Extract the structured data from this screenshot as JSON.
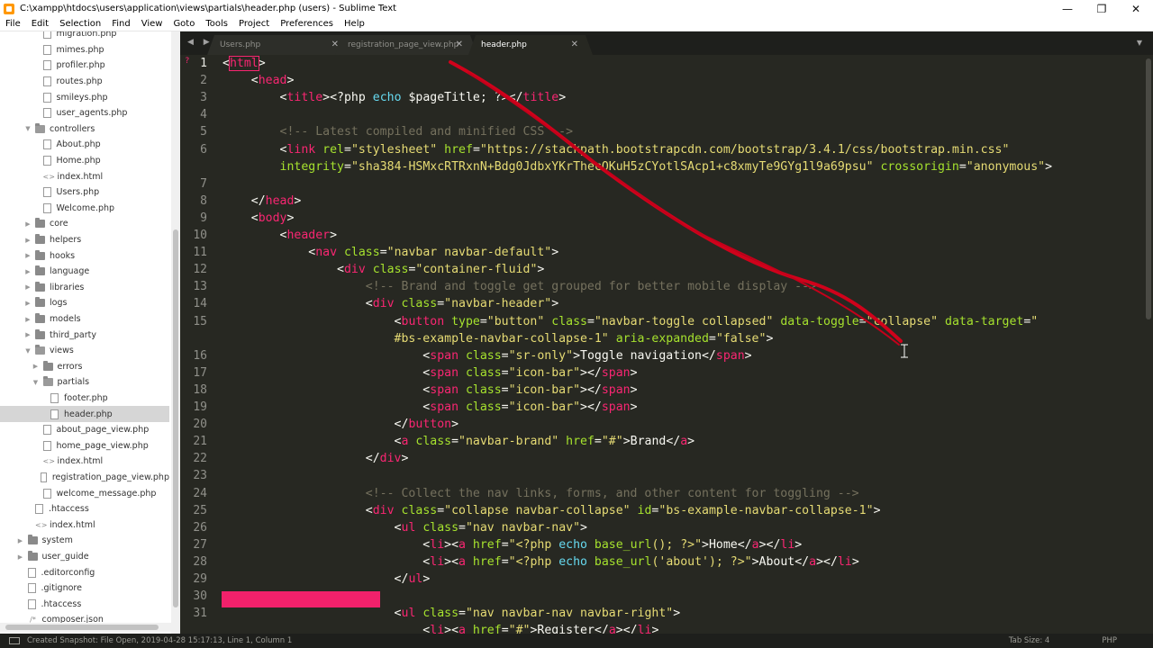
{
  "window": {
    "title": "C:\\xampp\\htdocs\\users\\application\\views\\partials\\header.php (users) - Sublime Text",
    "minimize": "—",
    "maximize": "❐",
    "close": "✕"
  },
  "menu": [
    "File",
    "Edit",
    "Selection",
    "Find",
    "View",
    "Goto",
    "Tools",
    "Project",
    "Preferences",
    "Help"
  ],
  "sidebar": {
    "items": [
      {
        "label": "migration.php",
        "kind": "file",
        "indent": 3
      },
      {
        "label": "mimes.php",
        "kind": "file",
        "indent": 3
      },
      {
        "label": "profiler.php",
        "kind": "file",
        "indent": 3
      },
      {
        "label": "routes.php",
        "kind": "file",
        "indent": 3
      },
      {
        "label": "smileys.php",
        "kind": "file",
        "indent": 3
      },
      {
        "label": "user_agents.php",
        "kind": "file",
        "indent": 3
      },
      {
        "label": "controllers",
        "kind": "folder-open",
        "indent": 2
      },
      {
        "label": "About.php",
        "kind": "file",
        "indent": 3
      },
      {
        "label": "Home.php",
        "kind": "file",
        "indent": 3
      },
      {
        "label": "index.html",
        "kind": "code",
        "indent": 3
      },
      {
        "label": "Users.php",
        "kind": "file",
        "indent": 3
      },
      {
        "label": "Welcome.php",
        "kind": "file",
        "indent": 3
      },
      {
        "label": "core",
        "kind": "folder",
        "indent": 2
      },
      {
        "label": "helpers",
        "kind": "folder",
        "indent": 2
      },
      {
        "label": "hooks",
        "kind": "folder",
        "indent": 2
      },
      {
        "label": "language",
        "kind": "folder",
        "indent": 2
      },
      {
        "label": "libraries",
        "kind": "folder",
        "indent": 2
      },
      {
        "label": "logs",
        "kind": "folder",
        "indent": 2
      },
      {
        "label": "models",
        "kind": "folder",
        "indent": 2
      },
      {
        "label": "third_party",
        "kind": "folder",
        "indent": 2
      },
      {
        "label": "views",
        "kind": "folder-open",
        "indent": 2
      },
      {
        "label": "errors",
        "kind": "folder",
        "indent": 3
      },
      {
        "label": "partials",
        "kind": "folder-open",
        "indent": 3
      },
      {
        "label": "footer.php",
        "kind": "file",
        "indent": 4
      },
      {
        "label": "header.php",
        "kind": "file",
        "indent": 4,
        "selected": true
      },
      {
        "label": "about_page_view.php",
        "kind": "file",
        "indent": 3
      },
      {
        "label": "home_page_view.php",
        "kind": "file",
        "indent": 3
      },
      {
        "label": "index.html",
        "kind": "code",
        "indent": 3
      },
      {
        "label": "registration_page_view.php",
        "kind": "file",
        "indent": 3
      },
      {
        "label": "welcome_message.php",
        "kind": "file",
        "indent": 3
      },
      {
        "label": ".htaccess",
        "kind": "file",
        "indent": 2
      },
      {
        "label": "index.html",
        "kind": "code",
        "indent": 2
      },
      {
        "label": "system",
        "kind": "folder",
        "indent": 1
      },
      {
        "label": "user_guide",
        "kind": "folder",
        "indent": 1
      },
      {
        "label": ".editorconfig",
        "kind": "file",
        "indent": 1
      },
      {
        "label": ".gitignore",
        "kind": "file",
        "indent": 1
      },
      {
        "label": ".htaccess",
        "kind": "file",
        "indent": 1
      },
      {
        "label": "composer.json",
        "kind": "json",
        "indent": 1
      }
    ]
  },
  "tabs": {
    "nav": "◀ ▶",
    "dropdown": "▼",
    "items": [
      {
        "label": "Users.php",
        "active": false
      },
      {
        "label": "registration_page_view.php",
        "active": false
      },
      {
        "label": "header.php",
        "active": true
      }
    ],
    "close_glyph": "✕"
  },
  "editor": {
    "current_line": 1,
    "error_marker": "?",
    "lines": [
      {
        "n": 1,
        "tokens": [
          [
            "v",
            "<"
          ],
          [
            "t",
            "html"
          ],
          [
            "v",
            ">"
          ]
        ]
      },
      {
        "n": 2,
        "tokens": [
          [
            "v",
            "    <"
          ],
          [
            "t",
            "head"
          ],
          [
            "v",
            ">"
          ]
        ]
      },
      {
        "n": 3,
        "tokens": [
          [
            "v",
            "        <"
          ],
          [
            "t",
            "title"
          ],
          [
            "v",
            "><?php "
          ],
          [
            "k",
            "echo"
          ],
          [
            "v",
            " $pageTitle; ?></"
          ],
          [
            "t",
            "title"
          ],
          [
            "v",
            ">"
          ]
        ]
      },
      {
        "n": 4,
        "tokens": []
      },
      {
        "n": 5,
        "tokens": [
          [
            "c",
            "        <!-- Latest compiled and minified CSS -->"
          ]
        ]
      },
      {
        "n": 6,
        "tokens": [
          [
            "v",
            "        <"
          ],
          [
            "t",
            "link"
          ],
          [
            "a",
            " rel"
          ],
          [
            "v",
            "="
          ],
          [
            "s",
            "\"stylesheet\""
          ],
          [
            "a",
            " href"
          ],
          [
            "v",
            "="
          ],
          [
            "s",
            "\"https://stackpath.bootstrapcdn.com/bootstrap/3.4.1/css/bootstrap.min.css\""
          ]
        ]
      },
      {
        "n": null,
        "tokens": [
          [
            "a",
            "        integrity"
          ],
          [
            "v",
            "="
          ],
          [
            "s",
            "\"sha384-HSMxcRTRxnN+Bdg0JdbxYKrThecOKuH5zCYotlSAcp1+c8xmyTe9GYg1l9a69psu\""
          ],
          [
            "a",
            " crossorigin"
          ],
          [
            "v",
            "="
          ],
          [
            "s",
            "\"anonymous\""
          ],
          [
            "v",
            ">"
          ]
        ]
      },
      {
        "n": 7,
        "tokens": []
      },
      {
        "n": 8,
        "tokens": [
          [
            "v",
            "    </"
          ],
          [
            "t",
            "head"
          ],
          [
            "v",
            ">"
          ]
        ]
      },
      {
        "n": 9,
        "tokens": [
          [
            "v",
            "    <"
          ],
          [
            "t",
            "body"
          ],
          [
            "v",
            ">"
          ]
        ]
      },
      {
        "n": 10,
        "tokens": [
          [
            "v",
            "        <"
          ],
          [
            "t",
            "header"
          ],
          [
            "v",
            ">"
          ]
        ]
      },
      {
        "n": 11,
        "tokens": [
          [
            "v",
            "            <"
          ],
          [
            "t",
            "nav"
          ],
          [
            "a",
            " class"
          ],
          [
            "v",
            "="
          ],
          [
            "s",
            "\"navbar navbar-default\""
          ],
          [
            "v",
            ">"
          ]
        ]
      },
      {
        "n": 12,
        "tokens": [
          [
            "v",
            "                <"
          ],
          [
            "t",
            "div"
          ],
          [
            "a",
            " class"
          ],
          [
            "v",
            "="
          ],
          [
            "s",
            "\"container-fluid\""
          ],
          [
            "v",
            ">"
          ]
        ]
      },
      {
        "n": 13,
        "tokens": [
          [
            "c",
            "                    <!-- Brand and toggle get grouped for better mobile display -->"
          ]
        ]
      },
      {
        "n": 14,
        "tokens": [
          [
            "v",
            "                    <"
          ],
          [
            "t",
            "div"
          ],
          [
            "a",
            " class"
          ],
          [
            "v",
            "="
          ],
          [
            "s",
            "\"navbar-header\""
          ],
          [
            "v",
            ">"
          ]
        ]
      },
      {
        "n": 15,
        "tokens": [
          [
            "v",
            "                        <"
          ],
          [
            "t",
            "button"
          ],
          [
            "a",
            " type"
          ],
          [
            "v",
            "="
          ],
          [
            "s",
            "\"button\""
          ],
          [
            "a",
            " class"
          ],
          [
            "v",
            "="
          ],
          [
            "s",
            "\"navbar-toggle collapsed\""
          ],
          [
            "a",
            " data-toggle"
          ],
          [
            "v",
            "="
          ],
          [
            "s",
            "\"collapse\""
          ],
          [
            "a",
            " data-target"
          ],
          [
            "v",
            "="
          ],
          [
            "s",
            "\""
          ]
        ]
      },
      {
        "n": null,
        "tokens": [
          [
            "s",
            "                        #bs-example-navbar-collapse-1\""
          ],
          [
            "a",
            " aria-expanded"
          ],
          [
            "v",
            "="
          ],
          [
            "s",
            "\"false\""
          ],
          [
            "v",
            ">"
          ]
        ]
      },
      {
        "n": 16,
        "tokens": [
          [
            "v",
            "                            <"
          ],
          [
            "t",
            "span"
          ],
          [
            "a",
            " class"
          ],
          [
            "v",
            "="
          ],
          [
            "s",
            "\"sr-only\""
          ],
          [
            "v",
            ">Toggle navigation</"
          ],
          [
            "t",
            "span"
          ],
          [
            "v",
            ">"
          ]
        ]
      },
      {
        "n": 17,
        "tokens": [
          [
            "v",
            "                            <"
          ],
          [
            "t",
            "span"
          ],
          [
            "a",
            " class"
          ],
          [
            "v",
            "="
          ],
          [
            "s",
            "\"icon-bar\""
          ],
          [
            "v",
            "></"
          ],
          [
            "t",
            "span"
          ],
          [
            "v",
            ">"
          ]
        ]
      },
      {
        "n": 18,
        "tokens": [
          [
            "v",
            "                            <"
          ],
          [
            "t",
            "span"
          ],
          [
            "a",
            " class"
          ],
          [
            "v",
            "="
          ],
          [
            "s",
            "\"icon-bar\""
          ],
          [
            "v",
            "></"
          ],
          [
            "t",
            "span"
          ],
          [
            "v",
            ">"
          ]
        ]
      },
      {
        "n": 19,
        "tokens": [
          [
            "v",
            "                            <"
          ],
          [
            "t",
            "span"
          ],
          [
            "a",
            " class"
          ],
          [
            "v",
            "="
          ],
          [
            "s",
            "\"icon-bar\""
          ],
          [
            "v",
            "></"
          ],
          [
            "t",
            "span"
          ],
          [
            "v",
            ">"
          ]
        ]
      },
      {
        "n": 20,
        "tokens": [
          [
            "v",
            "                        </"
          ],
          [
            "t",
            "button"
          ],
          [
            "v",
            ">"
          ]
        ]
      },
      {
        "n": 21,
        "tokens": [
          [
            "v",
            "                        <"
          ],
          [
            "t",
            "a"
          ],
          [
            "a",
            " class"
          ],
          [
            "v",
            "="
          ],
          [
            "s",
            "\"navbar-brand\""
          ],
          [
            "a",
            " href"
          ],
          [
            "v",
            "="
          ],
          [
            "s",
            "\"#\""
          ],
          [
            "v",
            ">Brand</"
          ],
          [
            "t",
            "a"
          ],
          [
            "v",
            ">"
          ]
        ]
      },
      {
        "n": 22,
        "tokens": [
          [
            "v",
            "                    </"
          ],
          [
            "t",
            "div"
          ],
          [
            "v",
            ">"
          ]
        ]
      },
      {
        "n": 23,
        "tokens": []
      },
      {
        "n": 24,
        "tokens": [
          [
            "c",
            "                    <!-- Collect the nav links, forms, and other content for toggling -->"
          ]
        ]
      },
      {
        "n": 25,
        "tokens": [
          [
            "v",
            "                    <"
          ],
          [
            "t",
            "div"
          ],
          [
            "a",
            " class"
          ],
          [
            "v",
            "="
          ],
          [
            "s",
            "\"collapse navbar-collapse\""
          ],
          [
            "a",
            " id"
          ],
          [
            "v",
            "="
          ],
          [
            "s",
            "\"bs-example-navbar-collapse-1\""
          ],
          [
            "v",
            ">"
          ]
        ]
      },
      {
        "n": 26,
        "tokens": [
          [
            "v",
            "                        <"
          ],
          [
            "t",
            "ul"
          ],
          [
            "a",
            " class"
          ],
          [
            "v",
            "="
          ],
          [
            "s",
            "\"nav navbar-nav\""
          ],
          [
            "v",
            ">"
          ]
        ]
      },
      {
        "n": 27,
        "tokens": [
          [
            "v",
            "                            <"
          ],
          [
            "t",
            "li"
          ],
          [
            "v",
            "><"
          ],
          [
            "t",
            "a"
          ],
          [
            "a",
            " href"
          ],
          [
            "v",
            "="
          ],
          [
            "s",
            "\"<?php "
          ],
          [
            "k",
            "echo"
          ],
          [
            "a",
            " base_url"
          ],
          [
            "s",
            "(); ?>\""
          ],
          [
            "v",
            ">Home</"
          ],
          [
            "t",
            "a"
          ],
          [
            "v",
            "></"
          ],
          [
            "t",
            "li"
          ],
          [
            "v",
            ">"
          ]
        ]
      },
      {
        "n": 28,
        "tokens": [
          [
            "v",
            "                            <"
          ],
          [
            "t",
            "li"
          ],
          [
            "v",
            "><"
          ],
          [
            "t",
            "a"
          ],
          [
            "a",
            " href"
          ],
          [
            "v",
            "="
          ],
          [
            "s",
            "\"<?php "
          ],
          [
            "k",
            "echo"
          ],
          [
            "a",
            " base_url"
          ],
          [
            "s",
            "('about'); ?>\""
          ],
          [
            "v",
            ">About</"
          ],
          [
            "t",
            "a"
          ],
          [
            "v",
            "></"
          ],
          [
            "t",
            "li"
          ],
          [
            "v",
            ">"
          ]
        ]
      },
      {
        "n": 29,
        "tokens": [
          [
            "v",
            "                        </"
          ],
          [
            "t",
            "ul"
          ],
          [
            "v",
            ">"
          ]
        ]
      },
      {
        "n": 30,
        "tokens": []
      },
      {
        "n": 31,
        "tokens": [
          [
            "v",
            "                        <"
          ],
          [
            "t",
            "ul"
          ],
          [
            "a",
            " class"
          ],
          [
            "v",
            "="
          ],
          [
            "s",
            "\"nav navbar-nav navbar-right\""
          ],
          [
            "v",
            ">"
          ]
        ]
      },
      {
        "n": null,
        "tokens": [
          [
            "v",
            "                            <"
          ],
          [
            "t",
            "li"
          ],
          [
            "v",
            "><"
          ],
          [
            "t",
            "a"
          ],
          [
            "a",
            " href"
          ],
          [
            "v",
            "="
          ],
          [
            "s",
            "\"#\""
          ],
          [
            "v",
            ">Register</"
          ],
          [
            "t",
            "a"
          ],
          [
            "v",
            "></"
          ],
          [
            "t",
            "li"
          ],
          [
            "v",
            ">"
          ]
        ]
      }
    ]
  },
  "status": {
    "message": "Created Snapshot: File Open, 2019-04-28 15:17:13, Line 1, Column 1",
    "tab_size": "Tab Size: 4",
    "syntax": "PHP"
  },
  "colors": {
    "background": "#272822",
    "tag": "#f92672",
    "attribute": "#a6e22e",
    "string": "#e6db74",
    "comment": "#75715e",
    "keyword": "#66d9ef",
    "annotation": "#d0021b",
    "highlight": "#f2216b"
  }
}
